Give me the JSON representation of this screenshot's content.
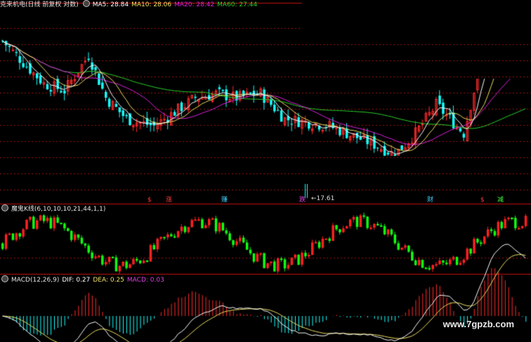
{
  "colors": {
    "background": "#000000",
    "up": "#ff2a2a",
    "down": "#17ffff",
    "kd_up": "#ff2020",
    "kd_down": "#10ff10",
    "ma5": "#ffffff",
    "ma10": "#f0e060",
    "ma20": "#e020e0",
    "ma60": "#2ad02a",
    "grid": "#9a1212",
    "divider": "#c01010",
    "dif": "#ffffff",
    "dea": "#f0e060",
    "macd": "#d030d0"
  },
  "header": {
    "stock": "克来机电(日线 前复权 对数)",
    "ma5": "MA5: 28.84",
    "ma10": "MA10: 28.06",
    "ma20": "MA20: 28.42",
    "ma60": "MA60: 27.44"
  },
  "markers": {
    "m1": "$",
    "m2": "涨",
    "m3": "赚",
    "m4": "跌",
    "m5": "财",
    "m6": "$",
    "m7": "减"
  },
  "low_label": "←17.61",
  "kd_header": {
    "title": "魔鬼K线(6,10,10,10,21,44,1,1)"
  },
  "macd_header": {
    "title": "MACD(12,26,9)",
    "dif": "DIF: 0.27",
    "dea": "DEA: 0.25",
    "macd": "MACD: 0.03"
  },
  "watermark": "www.7gpzb.com",
  "chart_data": {
    "type": "candlestick",
    "panels": [
      "price",
      "kd",
      "macd"
    ],
    "price_trend_anchors": [
      [
        0,
        31.5
      ],
      [
        6,
        30.0
      ],
      [
        12,
        28.5
      ],
      [
        18,
        28.0
      ],
      [
        25,
        30.5
      ],
      [
        30,
        27.5
      ],
      [
        36,
        26.0
      ],
      [
        44,
        25.5
      ],
      [
        50,
        26.5
      ],
      [
        56,
        27.5
      ],
      [
        62,
        27.8
      ],
      [
        68,
        27.5
      ],
      [
        75,
        27.8
      ],
      [
        82,
        26.0
      ],
      [
        88,
        25.8
      ],
      [
        95,
        25.5
      ],
      [
        102,
        24.8
      ],
      [
        108,
        24.2
      ],
      [
        114,
        23.5
      ],
      [
        120,
        25.0
      ],
      [
        126,
        27.0
      ],
      [
        130,
        26.0
      ],
      [
        134,
        25.0
      ],
      [
        138,
        29.0
      ],
      [
        142,
        32.0
      ],
      [
        148,
        32.0
      ],
      [
        152,
        31.5
      ]
    ],
    "price_ylim": [
      22.5,
      33.5
    ]
  }
}
